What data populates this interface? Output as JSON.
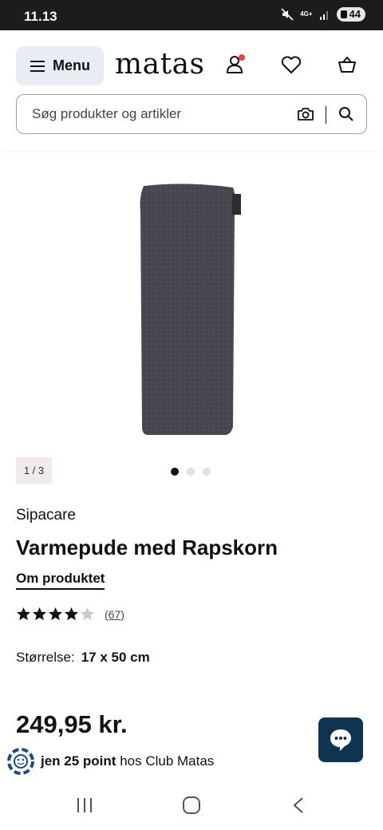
{
  "status_bar": {
    "time": "11.13",
    "network": "4G+",
    "battery": "44"
  },
  "header": {
    "menu_label": "Menu",
    "logo": "matas",
    "icons": [
      "user-icon",
      "heart-icon",
      "basket-icon"
    ],
    "notification_color": "#e8423d"
  },
  "search": {
    "placeholder": "Søg produkter og artikler"
  },
  "gallery": {
    "counter": "1 / 3",
    "slides": 3,
    "active_slide": 1
  },
  "product": {
    "brand": "Sipacare",
    "title": "Varmepude med Rapskorn",
    "about_link": "Om produktet",
    "rating": 4,
    "rating_max": 5,
    "review_count": "(67)",
    "size_label": "Størrelse:",
    "size_value": "17 x 50 cm",
    "price": "249,95 kr.",
    "points_bold": "jen 25 point",
    "points_rest": " hos Club Matas"
  },
  "colors": {
    "accent": "#0e3450",
    "menu_bg": "#e7edf2",
    "product": "#4a4650"
  }
}
